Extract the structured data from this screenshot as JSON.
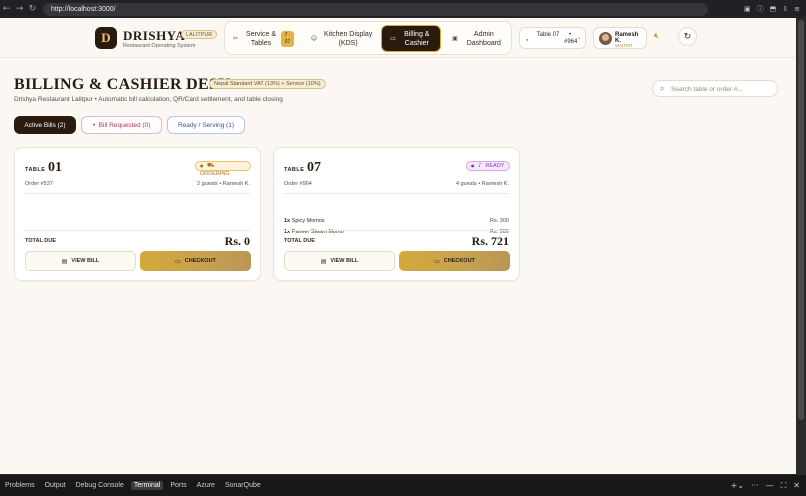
{
  "browser": {
    "url": "http://localhost:3000/",
    "nav": {
      "back": "←",
      "forward": "→",
      "reload": "↻"
    },
    "icons": [
      "reader-icon",
      "info-icon",
      "cast-icon",
      "download-icon",
      "menu-icon"
    ]
  },
  "header": {
    "logo_letter": "D",
    "brand": "DRISHYA",
    "location_badge": "LALITPUR",
    "subtitle": "Restaurant Operating System",
    "nav": [
      {
        "icon": "✂",
        "label": "Service & Tables",
        "badge": "7 · 07"
      },
      {
        "icon": "☺",
        "label": "Kitchen Display (KDS)"
      },
      {
        "icon": "▭",
        "label": "Billing & Cashier",
        "active": true
      },
      {
        "icon": "▣",
        "label": "Admin Dashboard"
      }
    ],
    "table_selector": {
      "label": "Table 07",
      "order": "• #964"
    },
    "user": {
      "name": "Ramesh K.",
      "role": "WAITER"
    }
  },
  "page": {
    "title": "BILLING & CASHIER DESK",
    "vat_badge": "Nepal Standard VAT (13%) + Service (10%)",
    "subtitle": "Drishya Restaurant Lalitpur • Automatic bill calculation, QR/Card settlement, and table closing",
    "search_placeholder": "Search table or order #..."
  },
  "tabs": {
    "active": "Active Bills (2)",
    "requested": "Bill Requested (0)",
    "ready": "Ready / Serving (1)"
  },
  "cards": [
    {
      "table_label": "TABLE",
      "table_num": "01",
      "status": "ORDERING",
      "order": "Order #537",
      "guests": "2 guests • Ramesh K.",
      "items": [],
      "total_label": "TOTAL DUE",
      "total": "Rs. 0",
      "view_label": "VIEW BILL",
      "checkout_label": "CHECKOUT"
    },
    {
      "table_label": "TABLE",
      "table_num": "07",
      "status": "READY",
      "order": "Order #964",
      "guests": "4 guests • Ramesh K.",
      "items": [
        {
          "qty": "1x",
          "name": "Spicy Momos",
          "price": "Rs. 300"
        },
        {
          "qty": "1x",
          "name": "Paneer Steam Momo",
          "price": "Rs. 280"
        }
      ],
      "total_label": "TOTAL DUE",
      "total": "Rs. 721",
      "view_label": "VIEW BILL",
      "checkout_label": "CHECKOUT"
    }
  ],
  "panel": {
    "tabs": [
      "Problems",
      "Output",
      "Debug Console",
      "Terminal",
      "Ports",
      "Azure",
      "SonarQube"
    ],
    "active_tab": "Terminal"
  },
  "colors": {
    "brand_dark": "#2a1b0f",
    "gold": "#d4a93a",
    "background": "#fbf8f3",
    "ordering": "#a77a1e",
    "ready": "#8a3cb5",
    "requested": "#b83355",
    "serving": "#3a4fa5"
  }
}
